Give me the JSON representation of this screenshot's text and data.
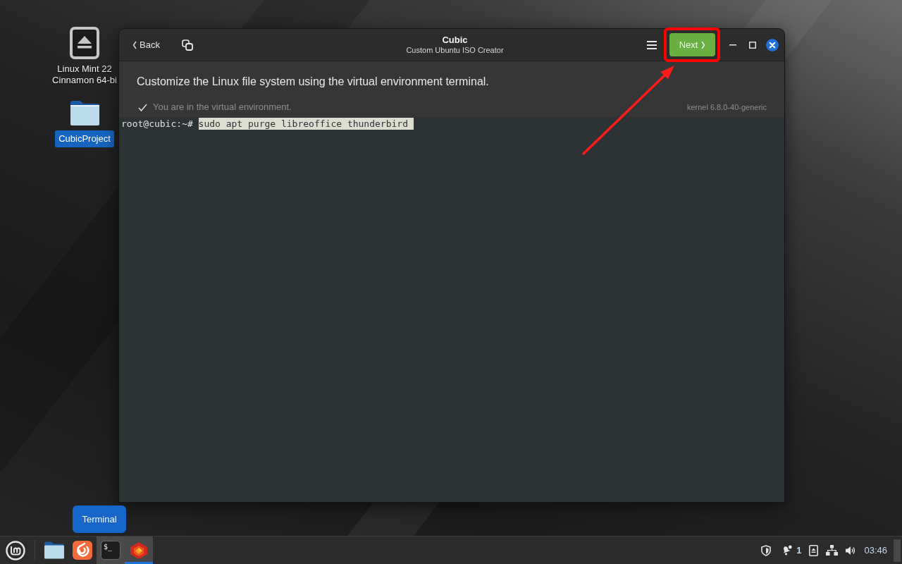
{
  "desktop": {
    "icons": [
      {
        "kind": "drive",
        "label": "Linux Mint 22 Cinnamon 64-bi",
        "selected": false
      },
      {
        "kind": "folder",
        "label": "CubicProject",
        "selected": true
      }
    ]
  },
  "window": {
    "back_button": "Back",
    "title": "Cubic",
    "subtitle": "Custom Ubuntu ISO Creator",
    "next_button": "Next",
    "instruction": "Customize the Linux file system using the virtual environment terminal.",
    "status": "You are in the virtual environment.",
    "kernel": "kernel 6.8.0-40-generic",
    "terminal": {
      "prompt": "root@cubic:~#",
      "command": "sudo apt purge libreoffice thunderbird",
      "command_selected": true
    }
  },
  "tooltip": "Terminal",
  "taskbar": {
    "apps": [
      {
        "kind": "files",
        "hovered": false,
        "active": false
      },
      {
        "kind": "web",
        "hovered": false,
        "active": false
      },
      {
        "kind": "terminal",
        "icon_text": "$_",
        "hovered": true,
        "active": false
      },
      {
        "kind": "cubic",
        "hovered": false,
        "active": true
      }
    ],
    "tray": {
      "notification_count": "1",
      "clock": "03:46"
    }
  }
}
